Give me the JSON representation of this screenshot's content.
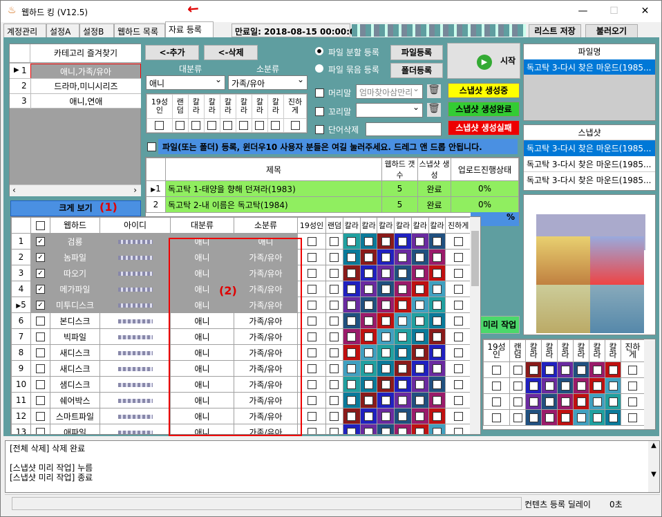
{
  "window": {
    "title": "웹하드 킹 (V12.5)"
  },
  "tabs": [
    "계정관리",
    "설정A",
    "설정B",
    "웹하드 목록",
    "자료 등록"
  ],
  "expiry": "만료일: 2018-08-15 00:00:00",
  "top_buttons": {
    "save": "리스트 저장",
    "load": "불러오기"
  },
  "favorites": {
    "header": "카테고리 즐겨찾기",
    "items": [
      {
        "n": "1",
        "label": "애니,가족/유아"
      },
      {
        "n": "2",
        "label": "드라마,미니시리즈"
      },
      {
        "n": "3",
        "label": "애니,연애"
      }
    ]
  },
  "category": {
    "add": "<-추가",
    "del": "<-삭제",
    "major_label": "대분류",
    "minor_label": "소분류",
    "major_value": "애니",
    "minor_value": "가족/유아",
    "flags": [
      "19성인",
      "랜덤",
      "칼라",
      "칼라",
      "칼라",
      "칼라",
      "칼라",
      "칼라",
      "진하게"
    ]
  },
  "upload": {
    "split": "파일 분할 등록",
    "bundle": "파일 묶음 등록",
    "file_reg": "파일등록",
    "folder_reg": "폴더등록",
    "start": "시작",
    "head": "머리말",
    "head_value": "엄마찾아삼만리",
    "tail": "꼬리말",
    "word_del": "단어삭제"
  },
  "snapshot_status": {
    "making": "스냅샷 생성중",
    "done": "스냅샷 생성완료",
    "fail": "스냅샷 생성실패"
  },
  "notice": "파일(또는 폴더) 등록, 윈더우10 사용자 분들은 여길 눌러주세요. 드레그 앤 드롭 안됩니다.",
  "files": {
    "headers": [
      "제목",
      "웹하드 갯수",
      "스냅샷 생성",
      "업로드진행상태"
    ],
    "rows": [
      {
        "n": "1",
        "title": "독고탁 1-태양을 향해 던져라(1983)",
        "count": "5",
        "snap": "완료",
        "progress": "0%"
      },
      {
        "n": "2",
        "title": "독고탁 2-내 이름은 독고탁(1984)",
        "count": "5",
        "snap": "완료",
        "progress": "0%"
      }
    ]
  },
  "filename_panel": {
    "header": "파일명",
    "items": [
      "독고탁 3-다시 찾은 마운드(1985..."
    ]
  },
  "snapshot_panel": {
    "header": "스냅샷",
    "items": [
      "독고탁 3-다시 찾은 마운드(1985...",
      "독고탁 3-다시 찾은 마운드(1985...",
      "독고탁 3-다시 찾은 마운드(1985..."
    ]
  },
  "pre_work": "미리 작업",
  "expand_btn": "크게 보기",
  "annot1": "(1)",
  "annot2": "(2)",
  "grid": {
    "headers": [
      "웹하드",
      "아이디",
      "대분류",
      "소분류",
      "19성인",
      "랜덤",
      "칼라",
      "칼라",
      "칼라",
      "칼라",
      "칼라",
      "칼라",
      "진하게"
    ],
    "rows": [
      {
        "n": "1",
        "name": "검룡",
        "major": "애니",
        "minor": "애니",
        "checked": true,
        "sel": true
      },
      {
        "n": "2",
        "name": "놈파일",
        "major": "애니",
        "minor": "가족/유아",
        "checked": true,
        "sel": true
      },
      {
        "n": "3",
        "name": "따오기",
        "major": "애니",
        "minor": "가족/유아",
        "checked": true,
        "sel": true
      },
      {
        "n": "4",
        "name": "메가파일",
        "major": "애니",
        "minor": "가족/유아",
        "checked": true,
        "sel": true
      },
      {
        "n": "5",
        "name": "미투디스크",
        "major": "애니",
        "minor": "가족/유아",
        "checked": true,
        "sel": true
      },
      {
        "n": "6",
        "name": "본디스크",
        "major": "애니",
        "minor": "가족/유아",
        "checked": false,
        "sel": false
      },
      {
        "n": "7",
        "name": "빅파일",
        "major": "애니",
        "minor": "가족/유아",
        "checked": false,
        "sel": false
      },
      {
        "n": "8",
        "name": "새디스크",
        "major": "애니",
        "minor": "가족/유아",
        "checked": false,
        "sel": false
      },
      {
        "n": "9",
        "name": "새디스크",
        "major": "애니",
        "minor": "가족/유아",
        "checked": false,
        "sel": false
      },
      {
        "n": "10",
        "name": "샘디스크",
        "major": "애니",
        "minor": "가족/유아",
        "checked": false,
        "sel": false
      },
      {
        "n": "11",
        "name": "쉐어박스",
        "major": "애니",
        "minor": "가족/유아",
        "checked": false,
        "sel": false
      },
      {
        "n": "12",
        "name": "스마트파일",
        "major": "애니",
        "minor": "가족/유아",
        "checked": false,
        "sel": false
      },
      {
        "n": "13",
        "name": "애파일",
        "major": "애니",
        "minor": "가족/유아",
        "checked": false,
        "sel": false
      }
    ]
  },
  "right_grid_headers": [
    "19성인",
    "랜덤",
    "칼라",
    "칼라",
    "칼라",
    "칼라",
    "칼라",
    "칼라",
    "진하게"
  ],
  "log": [
    "[전체 삭제] 삭제 완료",
    "",
    "[스냅샷 미리 작업] 누름",
    "[스냅샷 미리 작업] 종료"
  ],
  "status": {
    "delay_label": "컨텐츠 등록 딜레이",
    "delay_value": "0초"
  },
  "colors": [
    "#20a0a0",
    "#0a7a9a",
    "#8a1a1a",
    "#2020c0",
    "#6a2aa0",
    "#205080",
    "#9a1a6a",
    "#c01010",
    "#40a0c0"
  ]
}
